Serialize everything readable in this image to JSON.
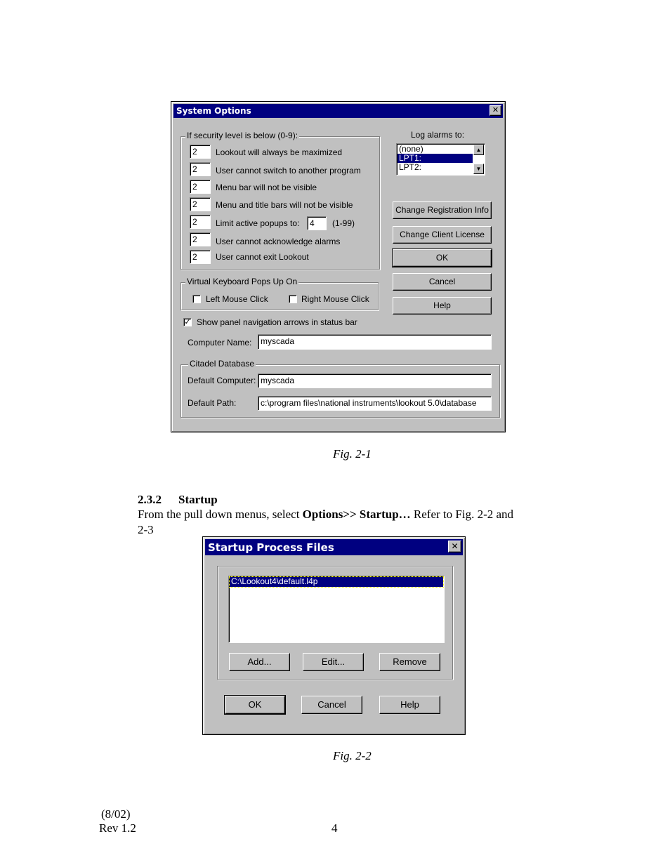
{
  "fig1": {
    "title": "System Options",
    "security_group_label": "If security level is below (0-9):",
    "security_rows": [
      {
        "value": "2",
        "label": "Lookout will always be maximized"
      },
      {
        "value": "2",
        "label": "User cannot switch to another program"
      },
      {
        "value": "2",
        "label": "Menu bar will not be visible"
      },
      {
        "value": "2",
        "label": "Menu and title bars will not be visible"
      },
      {
        "value": "2",
        "label": "Limit active popups to:"
      },
      {
        "value": "2",
        "label": "User cannot acknowledge alarms"
      },
      {
        "value": "2",
        "label": "User cannot exit Lookout"
      }
    ],
    "popups_limit_value": "4",
    "popups_range": "(1-99)",
    "log_alarms_label": "Log alarms to:",
    "log_alarms_options": [
      "(none)",
      "LPT1:",
      "LPT2:"
    ],
    "log_alarms_selected": "LPT1:",
    "buttons": {
      "change_registration": "Change Registration Info",
      "change_client_license": "Change Client License",
      "ok": "OK",
      "cancel": "Cancel",
      "help": "Help"
    },
    "keyboard_group_label": "Virtual Keyboard Pops Up On",
    "left_mouse_click": "Left Mouse Click",
    "right_mouse_click": "Right Mouse Click",
    "show_nav_arrows": "Show panel navigation arrows in status bar",
    "show_nav_checked": true,
    "computer_name_label": "Computer Name:",
    "computer_name_value": "myscada",
    "citadel_group_label": "Citadel Database",
    "default_computer_label": "Default Computer:",
    "default_computer_value": "myscada",
    "default_path_label": "Default Path:",
    "default_path_value": "c:\\program files\\national instruments\\lookout 5.0\\database"
  },
  "caption1": "Fig. 2-1",
  "section": {
    "number": "2.3.2",
    "title": "Startup",
    "text_before": "From the pull down menus, select ",
    "bold_1": "Options>> Startup…",
    "text_after": " Refer to Fig. 2-2 and",
    "text_line2": "2-3"
  },
  "fig2": {
    "title": "Startup Process Files",
    "files": [
      "C:\\Lookout4\\default.l4p"
    ],
    "buttons": {
      "add": "Add...",
      "edit": "Edit...",
      "remove": "Remove",
      "ok": "OK",
      "cancel": "Cancel",
      "help": "Help"
    }
  },
  "caption2": "Fig. 2-2",
  "footer": {
    "date": "(8/02)",
    "rev": "Rev 1.2",
    "page": "4"
  },
  "icons": {
    "close": "close-icon",
    "check": "check-icon",
    "arrow_up": "scroll-up-icon",
    "arrow_down": "scroll-down-icon"
  }
}
